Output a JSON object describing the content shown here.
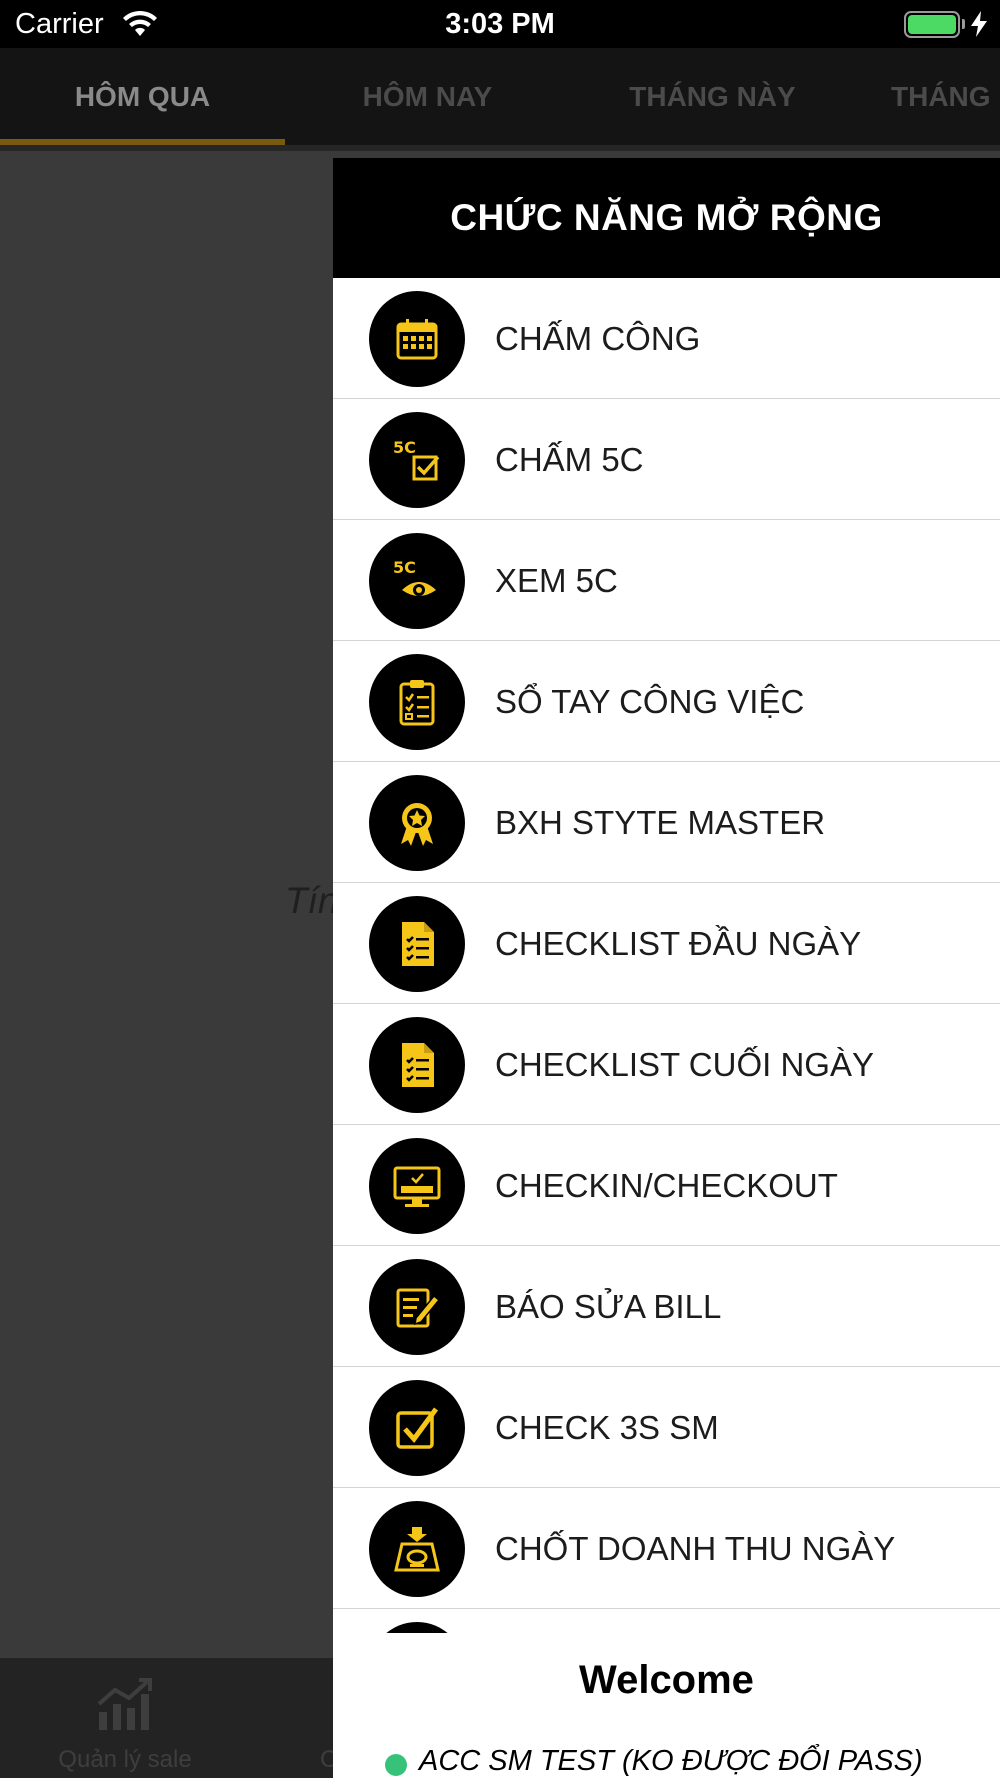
{
  "status_bar": {
    "carrier": "Carrier",
    "time": "3:03 PM"
  },
  "tabs": [
    {
      "label": "HÔM QUA",
      "active": true
    },
    {
      "label": "HÔM NAY",
      "active": false
    },
    {
      "label": "THÁNG NÀY",
      "active": false
    },
    {
      "label": "THÁNG",
      "active": false
    }
  ],
  "main": {
    "partial_text": "Tín"
  },
  "bottom_nav": [
    {
      "label": "Quản lý sale",
      "icon": "chart-icon"
    },
    {
      "label": "C",
      "icon": ""
    }
  ],
  "drawer": {
    "title": "CHỨC NĂNG MỞ RỘNG",
    "items": [
      {
        "label": "CHẤM CÔNG",
        "icon": "calendar-icon"
      },
      {
        "label": "CHẤM 5C",
        "icon": "5c-check-icon"
      },
      {
        "label": "XEM 5C",
        "icon": "5c-eye-icon"
      },
      {
        "label": "SỔ TAY CÔNG VIỆC",
        "icon": "clipboard-icon"
      },
      {
        "label": "BXH STYTE MASTER",
        "icon": "award-icon"
      },
      {
        "label": "CHECKLIST ĐẦU NGÀY",
        "icon": "checklist-doc-icon"
      },
      {
        "label": "CHECKLIST CUỐI NGÀY",
        "icon": "checklist-doc-icon"
      },
      {
        "label": "CHECKIN/CHECKOUT",
        "icon": "check-in-monitor-icon"
      },
      {
        "label": "BÁO SỬA BILL",
        "icon": "edit-bill-icon"
      },
      {
        "label": "CHECK 3S SM",
        "icon": "checkbox-icon"
      },
      {
        "label": "CHỐT DOANH THU NGÀY",
        "icon": "cash-register-icon"
      }
    ],
    "footer": {
      "welcome": "Welcome",
      "user": "ACC SM TEST (KO ĐƯỢC ĐỔI PASS)",
      "status_color": "#37c27a"
    }
  },
  "colors": {
    "icon_accent": "#f5c518",
    "tab_underline": "#7a5a0e"
  }
}
